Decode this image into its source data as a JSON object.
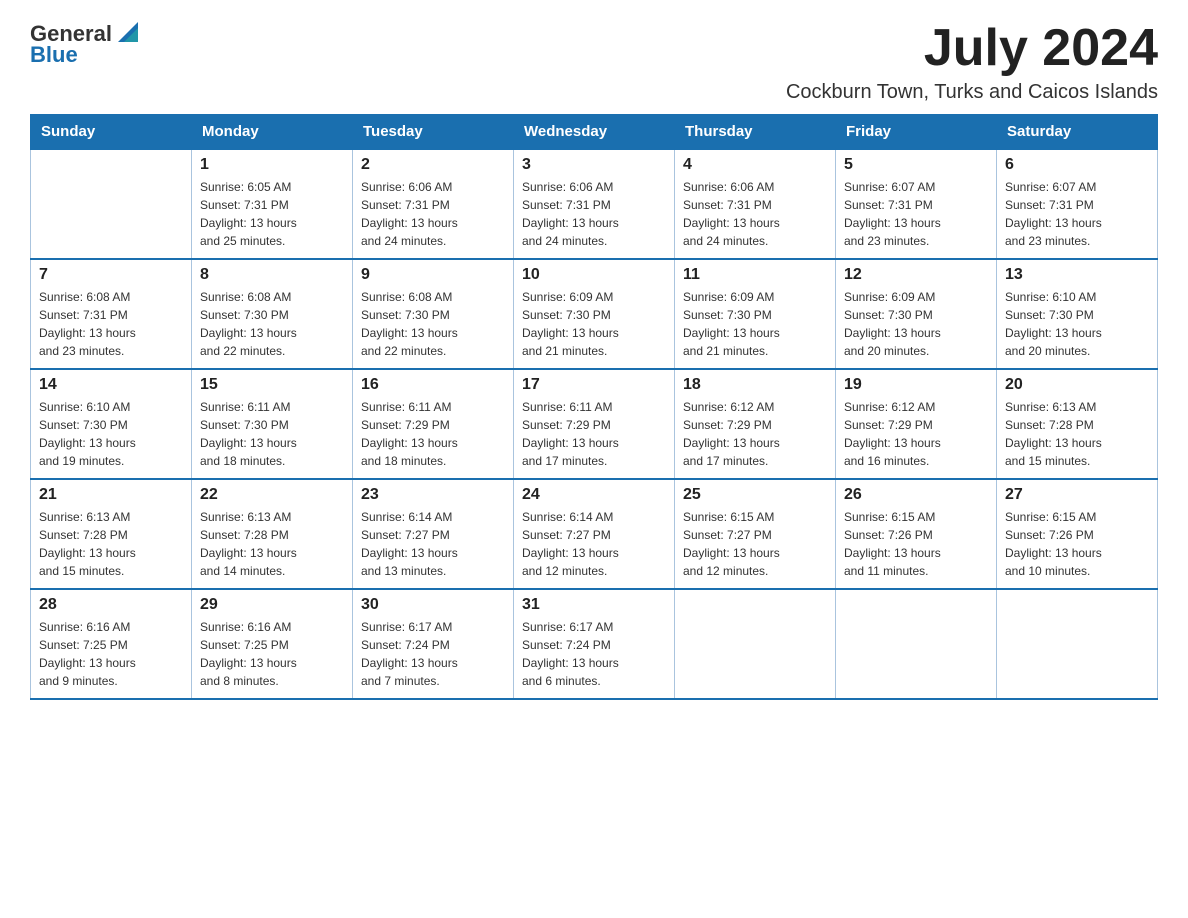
{
  "header": {
    "logo_general": "General",
    "logo_blue": "Blue",
    "month_title": "July 2024",
    "location": "Cockburn Town, Turks and Caicos Islands"
  },
  "days_of_week": [
    "Sunday",
    "Monday",
    "Tuesday",
    "Wednesday",
    "Thursday",
    "Friday",
    "Saturday"
  ],
  "weeks": [
    [
      {
        "num": "",
        "info": ""
      },
      {
        "num": "1",
        "info": "Sunrise: 6:05 AM\nSunset: 7:31 PM\nDaylight: 13 hours\nand 25 minutes."
      },
      {
        "num": "2",
        "info": "Sunrise: 6:06 AM\nSunset: 7:31 PM\nDaylight: 13 hours\nand 24 minutes."
      },
      {
        "num": "3",
        "info": "Sunrise: 6:06 AM\nSunset: 7:31 PM\nDaylight: 13 hours\nand 24 minutes."
      },
      {
        "num": "4",
        "info": "Sunrise: 6:06 AM\nSunset: 7:31 PM\nDaylight: 13 hours\nand 24 minutes."
      },
      {
        "num": "5",
        "info": "Sunrise: 6:07 AM\nSunset: 7:31 PM\nDaylight: 13 hours\nand 23 minutes."
      },
      {
        "num": "6",
        "info": "Sunrise: 6:07 AM\nSunset: 7:31 PM\nDaylight: 13 hours\nand 23 minutes."
      }
    ],
    [
      {
        "num": "7",
        "info": "Sunrise: 6:08 AM\nSunset: 7:31 PM\nDaylight: 13 hours\nand 23 minutes."
      },
      {
        "num": "8",
        "info": "Sunrise: 6:08 AM\nSunset: 7:30 PM\nDaylight: 13 hours\nand 22 minutes."
      },
      {
        "num": "9",
        "info": "Sunrise: 6:08 AM\nSunset: 7:30 PM\nDaylight: 13 hours\nand 22 minutes."
      },
      {
        "num": "10",
        "info": "Sunrise: 6:09 AM\nSunset: 7:30 PM\nDaylight: 13 hours\nand 21 minutes."
      },
      {
        "num": "11",
        "info": "Sunrise: 6:09 AM\nSunset: 7:30 PM\nDaylight: 13 hours\nand 21 minutes."
      },
      {
        "num": "12",
        "info": "Sunrise: 6:09 AM\nSunset: 7:30 PM\nDaylight: 13 hours\nand 20 minutes."
      },
      {
        "num": "13",
        "info": "Sunrise: 6:10 AM\nSunset: 7:30 PM\nDaylight: 13 hours\nand 20 minutes."
      }
    ],
    [
      {
        "num": "14",
        "info": "Sunrise: 6:10 AM\nSunset: 7:30 PM\nDaylight: 13 hours\nand 19 minutes."
      },
      {
        "num": "15",
        "info": "Sunrise: 6:11 AM\nSunset: 7:30 PM\nDaylight: 13 hours\nand 18 minutes."
      },
      {
        "num": "16",
        "info": "Sunrise: 6:11 AM\nSunset: 7:29 PM\nDaylight: 13 hours\nand 18 minutes."
      },
      {
        "num": "17",
        "info": "Sunrise: 6:11 AM\nSunset: 7:29 PM\nDaylight: 13 hours\nand 17 minutes."
      },
      {
        "num": "18",
        "info": "Sunrise: 6:12 AM\nSunset: 7:29 PM\nDaylight: 13 hours\nand 17 minutes."
      },
      {
        "num": "19",
        "info": "Sunrise: 6:12 AM\nSunset: 7:29 PM\nDaylight: 13 hours\nand 16 minutes."
      },
      {
        "num": "20",
        "info": "Sunrise: 6:13 AM\nSunset: 7:28 PM\nDaylight: 13 hours\nand 15 minutes."
      }
    ],
    [
      {
        "num": "21",
        "info": "Sunrise: 6:13 AM\nSunset: 7:28 PM\nDaylight: 13 hours\nand 15 minutes."
      },
      {
        "num": "22",
        "info": "Sunrise: 6:13 AM\nSunset: 7:28 PM\nDaylight: 13 hours\nand 14 minutes."
      },
      {
        "num": "23",
        "info": "Sunrise: 6:14 AM\nSunset: 7:27 PM\nDaylight: 13 hours\nand 13 minutes."
      },
      {
        "num": "24",
        "info": "Sunrise: 6:14 AM\nSunset: 7:27 PM\nDaylight: 13 hours\nand 12 minutes."
      },
      {
        "num": "25",
        "info": "Sunrise: 6:15 AM\nSunset: 7:27 PM\nDaylight: 13 hours\nand 12 minutes."
      },
      {
        "num": "26",
        "info": "Sunrise: 6:15 AM\nSunset: 7:26 PM\nDaylight: 13 hours\nand 11 minutes."
      },
      {
        "num": "27",
        "info": "Sunrise: 6:15 AM\nSunset: 7:26 PM\nDaylight: 13 hours\nand 10 minutes."
      }
    ],
    [
      {
        "num": "28",
        "info": "Sunrise: 6:16 AM\nSunset: 7:25 PM\nDaylight: 13 hours\nand 9 minutes."
      },
      {
        "num": "29",
        "info": "Sunrise: 6:16 AM\nSunset: 7:25 PM\nDaylight: 13 hours\nand 8 minutes."
      },
      {
        "num": "30",
        "info": "Sunrise: 6:17 AM\nSunset: 7:24 PM\nDaylight: 13 hours\nand 7 minutes."
      },
      {
        "num": "31",
        "info": "Sunrise: 6:17 AM\nSunset: 7:24 PM\nDaylight: 13 hours\nand 6 minutes."
      },
      {
        "num": "",
        "info": ""
      },
      {
        "num": "",
        "info": ""
      },
      {
        "num": "",
        "info": ""
      }
    ]
  ]
}
